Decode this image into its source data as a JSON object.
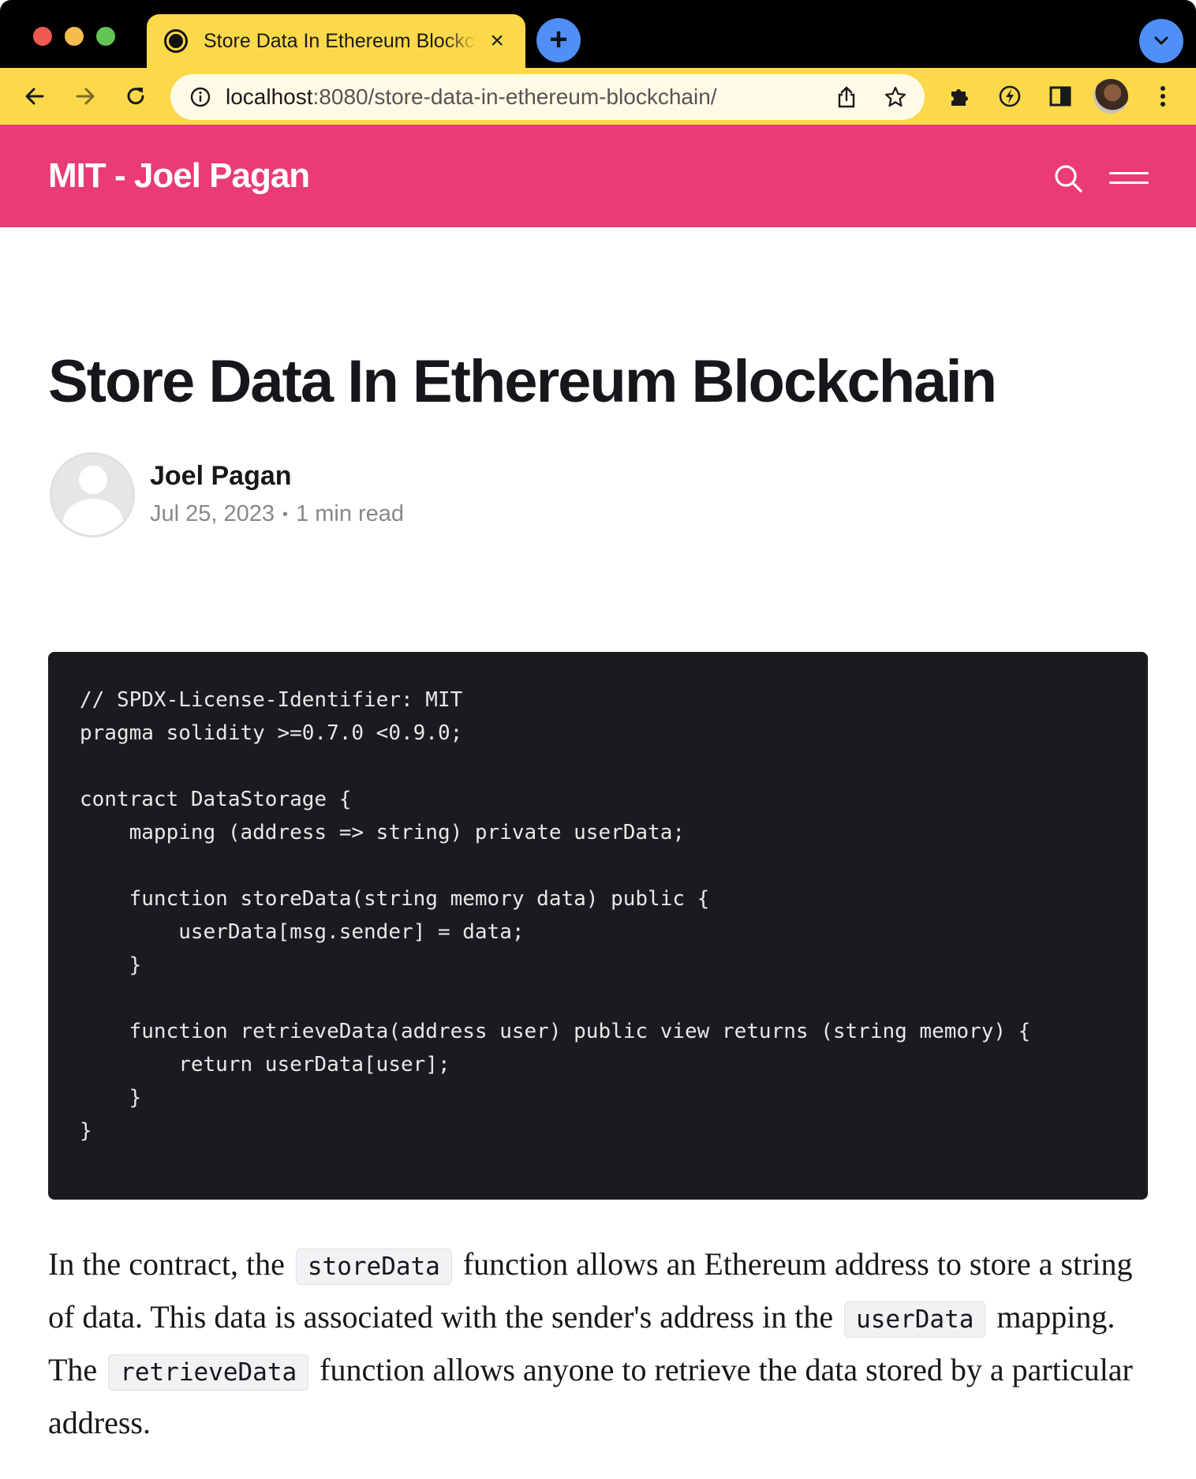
{
  "browser": {
    "tab_title": "Store Data In Ethereum Blockchain",
    "url_host": "localhost",
    "url_path": ":8080/store-data-in-ethereum-blockchain/",
    "icons": [
      "back-icon",
      "forward-icon",
      "reload-icon",
      "info-icon",
      "share-icon",
      "star-icon",
      "extensions-icon",
      "lightning-icon",
      "sidebar-icon",
      "profile-avatar",
      "kebab-menu-icon"
    ]
  },
  "site": {
    "title": "MIT - Joel Pagan",
    "accent_color": "#e93b77"
  },
  "article": {
    "title": "Store Data In Ethereum Blockchain",
    "author": "Joel Pagan",
    "date": "Jul 25, 2023",
    "separator": "•",
    "read_time": "1 min read",
    "code": "// SPDX-License-Identifier: MIT\npragma solidity >=0.7.0 <0.9.0;\n\ncontract DataStorage {\n    mapping (address => string) private userData;\n\n    function storeData(string memory data) public {\n        userData[msg.sender] = data;\n    }\n\n    function retrieveData(address user) public view returns (string memory) {\n        return userData[user];\n    }\n}",
    "paragraph": {
      "t1": "In the contract, the",
      "c1": "storeData",
      "t2": "function allows an Ethereum address to store a string of data. This data is associated with the sender's address in the",
      "c2": "userData",
      "t3": "mapping. The",
      "c3": "retrieveData",
      "t4": "function allows anyone to retrieve the data stored by a particular address."
    }
  }
}
